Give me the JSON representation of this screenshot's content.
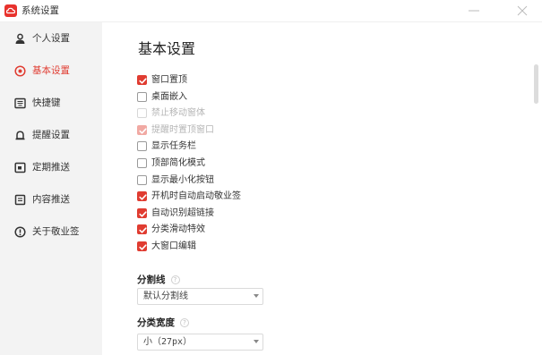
{
  "window": {
    "title": "系统设置",
    "minimize_icon": "minimize-icon",
    "close_icon": "close-icon",
    "brand_color": "#e8322d"
  },
  "sidebar": {
    "active_color": "#e03c31",
    "items": [
      {
        "label": "个人设置",
        "icon": "person-icon"
      },
      {
        "label": "基本设置",
        "icon": "target-icon"
      },
      {
        "label": "快捷键",
        "icon": "keyboard-icon"
      },
      {
        "label": "提醒设置",
        "icon": "bell-icon"
      },
      {
        "label": "定期推送",
        "icon": "calendar-icon"
      },
      {
        "label": "内容推送",
        "icon": "document-icon"
      },
      {
        "label": "关于敬业签",
        "icon": "info-icon"
      }
    ]
  },
  "main": {
    "title": "基本设置",
    "options": [
      {
        "label": "窗口置顶",
        "state": "checked"
      },
      {
        "label": "桌面嵌入",
        "state": "unchecked"
      },
      {
        "label": "禁止移动窗体",
        "state": "disabled"
      },
      {
        "label": "提醒时置顶窗口",
        "state": "checked-disabled"
      },
      {
        "label": "显示任务栏",
        "state": "unchecked"
      },
      {
        "label": "顶部简化模式",
        "state": "unchecked"
      },
      {
        "label": "显示最小化按钮",
        "state": "unchecked"
      },
      {
        "label": "开机时自动启动敬业签",
        "state": "checked"
      },
      {
        "label": "自动识别超链接",
        "state": "checked"
      },
      {
        "label": "分类滑动特效",
        "state": "checked"
      },
      {
        "label": "大窗口编辑",
        "state": "checked"
      }
    ],
    "divider_field": {
      "label": "分割线",
      "help": "?",
      "value": "默认分割线"
    },
    "category_width_field": {
      "label": "分类宽度",
      "help": "?",
      "value": "小（27px）"
    }
  }
}
